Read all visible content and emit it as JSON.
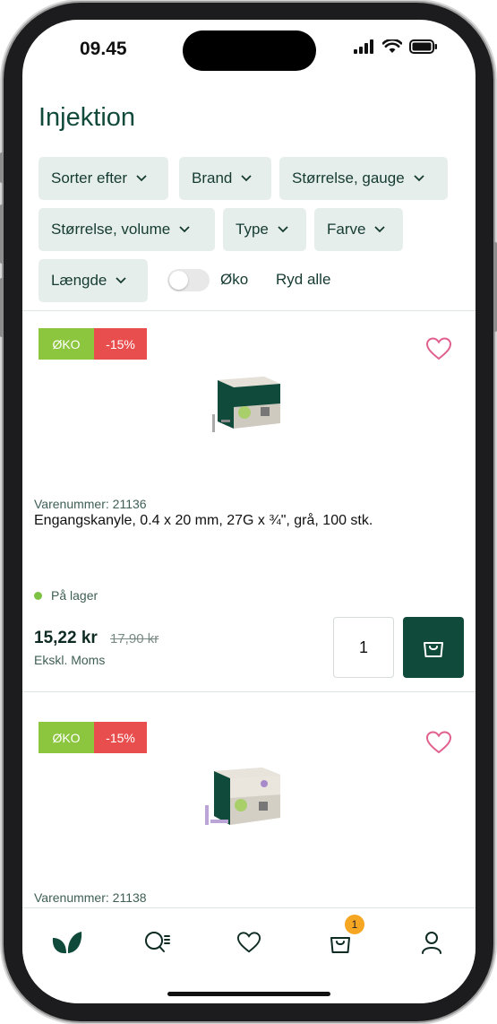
{
  "status_bar": {
    "time": "09.45"
  },
  "page": {
    "title": "Injektion"
  },
  "filters": {
    "chips": [
      "Sorter efter",
      "Brand",
      "Størrelse, gauge",
      "Størrelse, volume",
      "Type",
      "Farve",
      "Længde"
    ],
    "eco_toggle_label": "Øko",
    "eco_toggle_on": false,
    "clear_all": "Ryd alle"
  },
  "products": [
    {
      "badges": [
        "ØKO",
        "-15%"
      ],
      "sku": "Varenummer: 21136",
      "name": "Engangskanyle, 0.4 x 20 mm, 27G x ¾\", grå, 100 stk.",
      "stock": "På lager",
      "price": "15,22 kr",
      "old_price": "17,90 kr",
      "tax_note": "Ekskl. Moms",
      "quantity": "1"
    },
    {
      "badges": [
        "ØKO",
        "-15%"
      ],
      "sku": "Varenummer: 21138"
    }
  ],
  "bottom_nav": {
    "items": [
      "home-leaf-icon",
      "search-icon",
      "heart-icon",
      "cart-icon",
      "user-icon"
    ],
    "cart_count": "1"
  },
  "colors": {
    "brand_green": "#0f4a3a",
    "eco_badge": "#8cc63f",
    "discount_badge": "#e94e4e",
    "heart": "#e0608e",
    "chip_bg": "#e6eeeb",
    "cart_badge": "#f5a623"
  }
}
